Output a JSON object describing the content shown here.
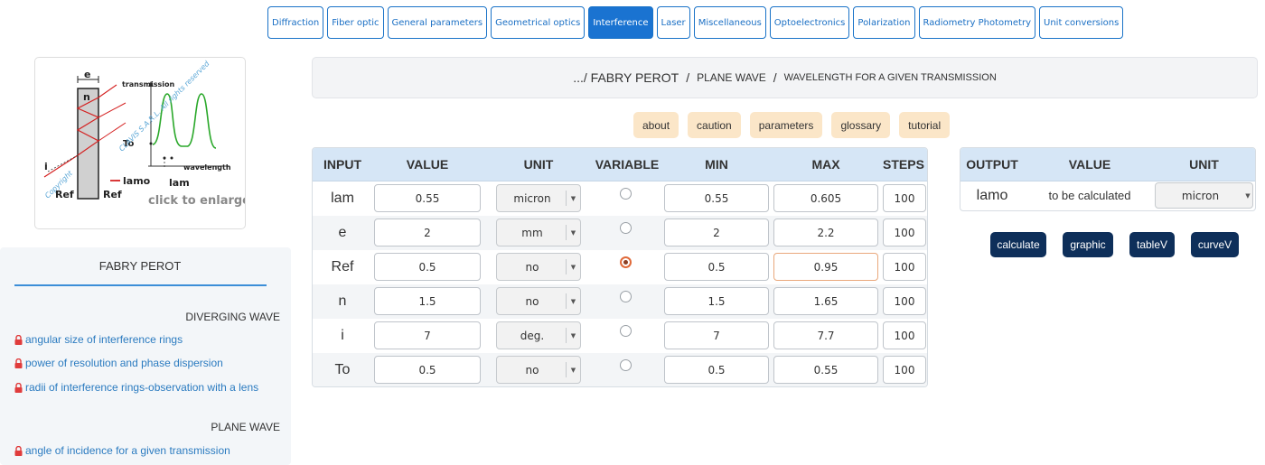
{
  "nav": {
    "items": [
      {
        "label": "Diffraction",
        "active": false
      },
      {
        "label": "Fiber optic",
        "active": false
      },
      {
        "label": "General parameters",
        "active": false
      },
      {
        "label": "Geometrical optics",
        "active": false
      },
      {
        "label": "Interference",
        "active": true
      },
      {
        "label": "Laser",
        "active": false
      },
      {
        "label": "Miscellaneous",
        "active": false
      },
      {
        "label": "Optoelectronics",
        "active": false
      },
      {
        "label": "Polarization",
        "active": false
      },
      {
        "label": "Radiometry Photometry",
        "active": false
      },
      {
        "label": "Unit conversions",
        "active": false
      }
    ]
  },
  "thumbnail": {
    "e_label": "e",
    "n_label": "n",
    "transmission_label": "transmission",
    "to_label": "To",
    "i_label": "i",
    "lamo_label": "lamo",
    "lam_label": "lam",
    "wavelength_label": "wavelength",
    "ref_left": "Ref",
    "ref_right": "Ref",
    "watermark": "CLAVIS S.A.R.L. All rights reserved",
    "copyright": "Copyright",
    "click_label": "click to enlarge"
  },
  "leftpanel": {
    "title": "FABRY PEROT",
    "section1": "DIVERGING WAVE",
    "links1": [
      "angular size of interference rings",
      "power of resolution and phase dispersion",
      "radii of interference rings-observation with a lens"
    ],
    "section2": "PLANE WAVE",
    "links2": [
      "angle of incidence for a given transmission"
    ]
  },
  "breadcrumb": {
    "part1": ".../ FABRY PEROT",
    "sep": "/",
    "part2": "PLANE WAVE",
    "part3": "WAVELENGTH FOR A GIVEN TRANSMISSION"
  },
  "help": {
    "about": "about",
    "caution": "caution",
    "parameters": "parameters",
    "glossary": "glossary",
    "tutorial": "tutorial"
  },
  "input": {
    "headers": {
      "input": "INPUT",
      "value": "VALUE",
      "unit": "UNIT",
      "variable": "VARIABLE",
      "min": "MIN",
      "max": "MAX",
      "steps": "STEPS"
    },
    "rows": [
      {
        "label": "lam",
        "value": "0.55",
        "unit": "micron",
        "variable": false,
        "min": "0.55",
        "max": "0.605",
        "steps": "100"
      },
      {
        "label": "e",
        "value": "2",
        "unit": "mm",
        "variable": false,
        "min": "2",
        "max": "2.2",
        "steps": "100"
      },
      {
        "label": "Ref",
        "value": "0.5",
        "unit": "no",
        "variable": true,
        "min": "0.5",
        "max": "0.95",
        "steps": "100"
      },
      {
        "label": "n",
        "value": "1.5",
        "unit": "no",
        "variable": false,
        "min": "1.5",
        "max": "1.65",
        "steps": "100"
      },
      {
        "label": "i",
        "value": "7",
        "unit": "deg.",
        "variable": false,
        "min": "7",
        "max": "7.7",
        "steps": "100"
      },
      {
        "label": "To",
        "value": "0.5",
        "unit": "no",
        "variable": false,
        "min": "0.5",
        "max": "0.55",
        "steps": "100"
      }
    ]
  },
  "output": {
    "headers": {
      "output": "OUTPUT",
      "value": "VALUE",
      "unit": "UNIT"
    },
    "label": "lamo",
    "value": "to be calculated",
    "unit": "micron"
  },
  "actions": {
    "calculate": "calculate",
    "graphic": "graphic",
    "tableV": "tableV",
    "curveV": "curveV"
  },
  "colors": {
    "nav_active": "#1a73d1",
    "table_header": "#d6e6f6",
    "help_button": "#fbe6c8",
    "action_button": "#0e2f5a",
    "link": "#2b7bc0",
    "lock": "#e03c3c"
  }
}
